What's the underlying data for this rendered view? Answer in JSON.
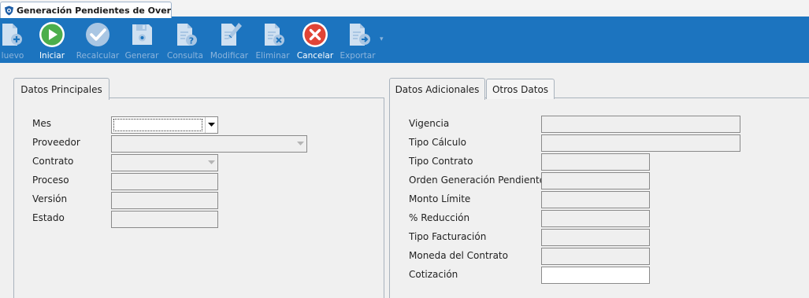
{
  "window": {
    "tab_title": "Generación Pendientes de Overc...",
    "tab_icon": "app-shield-icon"
  },
  "toolbar": {
    "buttons": [
      {
        "label": "Nuevo",
        "icon": "new-document-icon",
        "enabled": false,
        "visible_label": "luevo"
      },
      {
        "label": "Iniciar",
        "icon": "play-icon",
        "enabled": true
      },
      {
        "label": "Recalcular",
        "icon": "checkmark-icon",
        "enabled": false
      },
      {
        "label": "Generar",
        "icon": "save-disk-icon",
        "enabled": false
      },
      {
        "label": "Consulta",
        "icon": "query-document-icon",
        "enabled": false
      },
      {
        "label": "Modificar",
        "icon": "edit-pencil-icon",
        "enabled": false
      },
      {
        "label": "Eliminar",
        "icon": "delete-document-icon",
        "enabled": false
      },
      {
        "label": "Cancelar",
        "icon": "cancel-icon",
        "enabled": true
      },
      {
        "label": "Exportar",
        "icon": "export-document-icon",
        "enabled": false
      }
    ]
  },
  "colors": {
    "toolbar_bg": "#1c74bf",
    "play_green": "#4cae4c",
    "cancel_red": "#e04436",
    "disabled_text": "#8db5dc"
  },
  "left_panel": {
    "tab": "Datos Principales",
    "fields": {
      "mes": {
        "label": "Mes",
        "value": ""
      },
      "proveedor": {
        "label": "Proveedor",
        "value": ""
      },
      "contrato": {
        "label": "Contrato",
        "value": ""
      },
      "proceso": {
        "label": "Proceso",
        "value": ""
      },
      "version": {
        "label": "Versión",
        "value": ""
      },
      "estado": {
        "label": "Estado",
        "value": ""
      }
    }
  },
  "right_panel": {
    "tabs": [
      "Datos Adicionales",
      "Otros Datos"
    ],
    "active_tab": "Datos Adicionales",
    "fields": {
      "vigencia": {
        "label": "Vigencia",
        "value": ""
      },
      "tipo_calculo": {
        "label": "Tipo Cálculo",
        "value": ""
      },
      "tipo_contrato": {
        "label": "Tipo Contrato",
        "value": ""
      },
      "orden_generacion": {
        "label": "Orden Generación Pendiente",
        "value": ""
      },
      "monto_limite": {
        "label": "Monto Límite",
        "value": ""
      },
      "reduccion": {
        "label": "% Reducción",
        "value": ""
      },
      "tipo_facturacion": {
        "label": "Tipo Facturación",
        "value": ""
      },
      "moneda": {
        "label": "Moneda del Contrato",
        "value": ""
      },
      "cotizacion": {
        "label": "Cotización",
        "value": ""
      }
    }
  }
}
